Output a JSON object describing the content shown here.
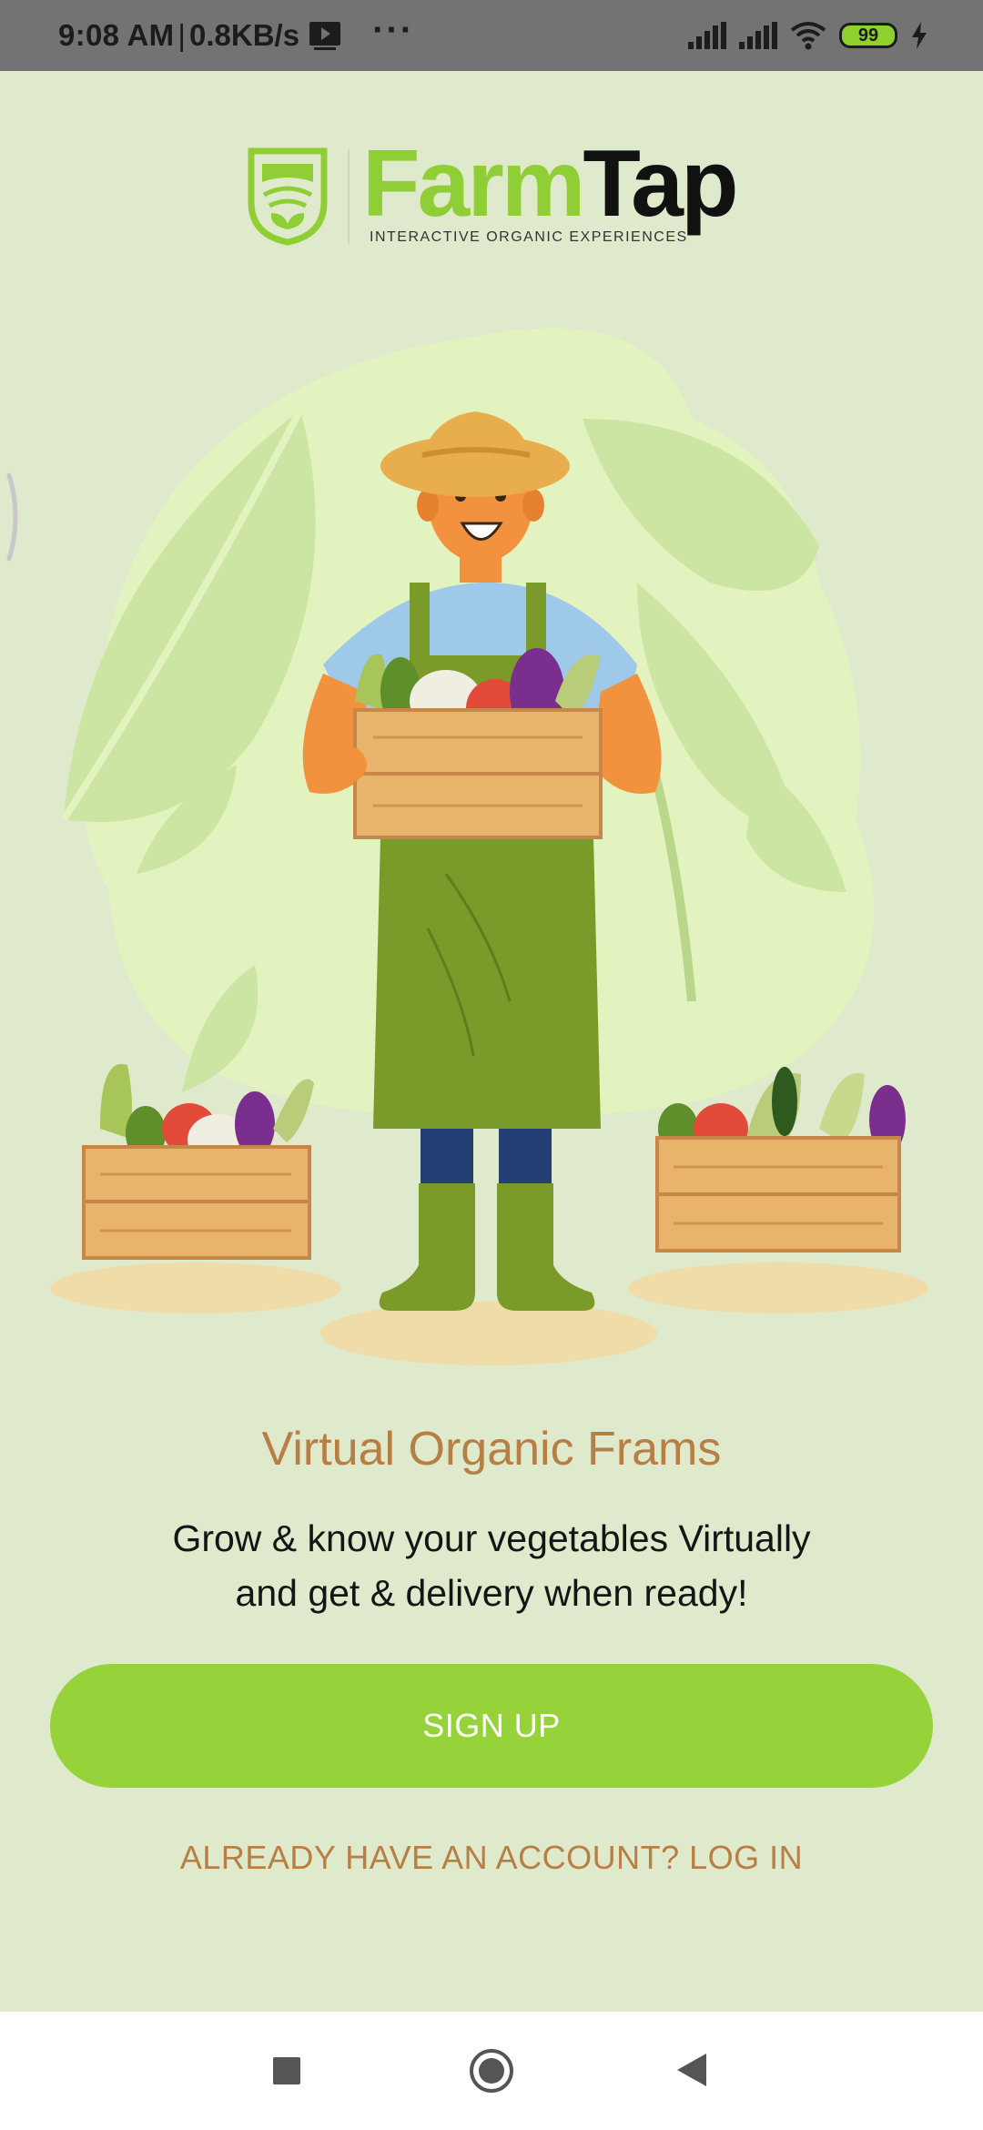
{
  "status_bar": {
    "time": "9:08 AM",
    "separator": "|",
    "speed": "0.8KB/s",
    "more": "···",
    "battery": "99"
  },
  "logo": {
    "farm": "Farm",
    "tap": "Tap",
    "tagline": "INTERACTIVE ORGANIC EXPERIENCES"
  },
  "onboarding": {
    "headline": "Virtual Organic Frams",
    "subtext_line1": "Grow & know your vegetables Virtually",
    "subtext_line2": "and get & delivery when ready!"
  },
  "actions": {
    "signup_label": "SIGN UP",
    "login_label": "ALREADY HAVE AN ACCOUNT? LOG IN"
  },
  "icons": {
    "media": "media-notification-icon",
    "signal": "signal-icon",
    "wifi": "wifi-icon",
    "charging": "charging-bolt-icon",
    "recents": "recents-square-icon",
    "home": "home-circle-icon",
    "back": "back-triangle-icon"
  },
  "colors": {
    "background": "#dfeacd",
    "accent_green": "#96d33a",
    "text_brown": "#b87f45"
  }
}
